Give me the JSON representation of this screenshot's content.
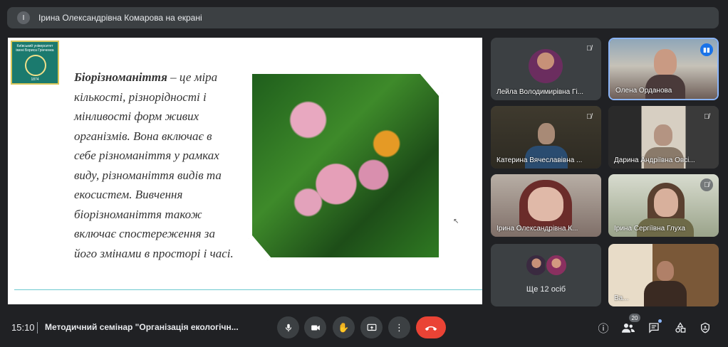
{
  "presenter": {
    "initial": "І",
    "label": "Ірина Олександрівна Комарова на екрані"
  },
  "slide": {
    "logo": {
      "text": "Київський університет імені Бориса Грінченка",
      "year": "1874"
    },
    "term": "Біорізноманіття",
    "definition": " – це міра кількості, різнорідності і мінливості форм живих організмів. Вона включає в себе різноманіття у рамках виду, різноманіття видів та екосистем. Вивчення біорізноманіття також включає спостереження за його змінами в просторі і часі."
  },
  "participants": [
    {
      "name": "Лейла Володимирівна Гі...",
      "muted": true
    },
    {
      "name": "Олена Орданова",
      "speaking": true
    },
    {
      "name": "Катерина Вячеславівна ...",
      "muted": true
    },
    {
      "name": "Дарина Андріївна Овсі...",
      "muted": true
    },
    {
      "name": "Ірина Олександрівна К...",
      "muted": false
    },
    {
      "name": "Ірина Сергіївна Глуха",
      "muted": true
    },
    {
      "name": "Ще 12 осіб"
    },
    {
      "name": "Ва..."
    }
  ],
  "bottom": {
    "time": "15:10",
    "meeting_title": "Методичний семінар \"Організація екологічн...",
    "people_count": "20"
  },
  "colors": {
    "background": "#202124",
    "tile": "#3c4043",
    "end_call": "#ea4335",
    "accent": "#8ab4f8"
  }
}
